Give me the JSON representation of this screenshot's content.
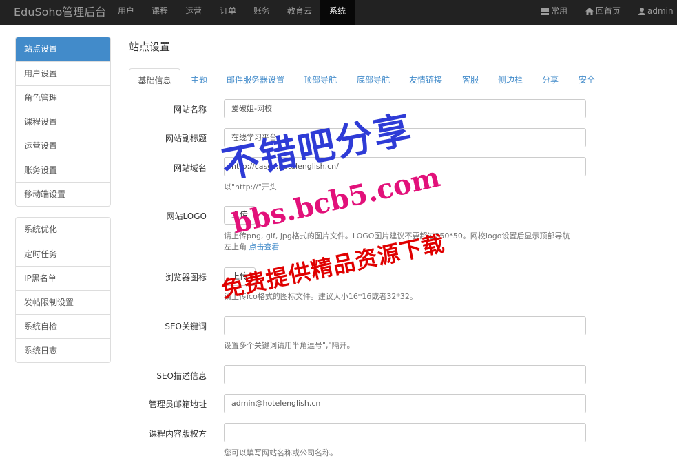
{
  "navbar": {
    "brand": "EduSoho管理后台",
    "items": [
      "用户",
      "课程",
      "运营",
      "订单",
      "账务",
      "教育云",
      "系统"
    ],
    "active": "系统",
    "right": {
      "common": "常用",
      "home": "回首页",
      "user": "admin"
    }
  },
  "sidebar": {
    "group1": [
      "站点设置",
      "用户设置",
      "角色管理",
      "课程设置",
      "运营设置",
      "账务设置",
      "移动端设置"
    ],
    "group2": [
      "系统优化",
      "定时任务",
      "IP黑名单",
      "发帖限制设置",
      "系统自检",
      "系统日志"
    ],
    "active": "站点设置"
  },
  "page": {
    "title": "站点设置"
  },
  "tabs": [
    "基础信息",
    "主题",
    "邮件服务器设置",
    "顶部导航",
    "底部导航",
    "友情链接",
    "客服",
    "侧边栏",
    "分享",
    "安全"
  ],
  "form": {
    "site_name": {
      "label": "网站名称",
      "value": "爱破姐-网校"
    },
    "site_slogan": {
      "label": "网站副标题",
      "value": "在线学习平台"
    },
    "site_url": {
      "label": "网站域名",
      "value": "http://cases.hotelenglish.cn/",
      "help": "以\"http://\"开头"
    },
    "logo": {
      "label": "网站LOGO",
      "button": "上传",
      "help_line1": "请上传png, gif, jpg格式的图片文件。LOGO图片建议不要超过250*50。网校logo设置后显示顶部导航",
      "help_line2": "左上角",
      "help_link": "点击查看"
    },
    "favicon": {
      "label": "浏览器图标",
      "button": "上传",
      "help": "请上传ico格式的图标文件。建议大小16*16或者32*32。"
    },
    "seo_keywords": {
      "label": "SEO关键词",
      "value": "",
      "help": "设置多个关键词请用半角逗号\",\"隔开。"
    },
    "seo_description": {
      "label": "SEO描述信息",
      "value": ""
    },
    "master_email": {
      "label": "管理员邮箱地址",
      "value": "admin@hotelenglish.cn"
    },
    "copyright": {
      "label": "课程内容版权方",
      "value": "",
      "help": "您可以填写网站名称或公司名称。"
    }
  },
  "watermark": {
    "line1": "不错吧分享",
    "line2": "bbs.bcb5.com",
    "line3": "免费提供精品资源下载"
  },
  "colors": {
    "navbar_bg": "#222222",
    "accent": "#428bca",
    "watermark_blue": "#2e3bd6",
    "watermark_pink": "#e2117a",
    "watermark_red": "#e00000"
  }
}
